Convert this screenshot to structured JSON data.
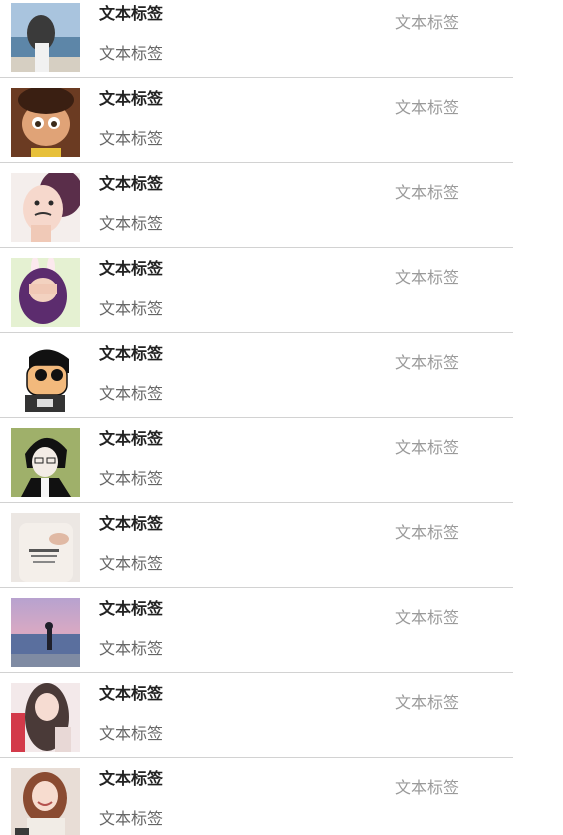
{
  "rows": [
    {
      "title": "文本标签",
      "subtitle": "文本标签",
      "side": "文本标签",
      "avatar": "beach-girl-avatar"
    },
    {
      "title": "文本标签",
      "subtitle": "文本标签",
      "side": "文本标签",
      "avatar": "cartoon-girl-avatar"
    },
    {
      "title": "文本标签",
      "subtitle": "文本标签",
      "side": "文本标签",
      "avatar": "mustache-girl-avatar"
    },
    {
      "title": "文本标签",
      "subtitle": "文本标签",
      "side": "文本标签",
      "avatar": "bunny-ears-girl-avatar"
    },
    {
      "title": "文本标签",
      "subtitle": "文本标签",
      "side": "文本标签",
      "avatar": "sunglasses-cartoon-avatar"
    },
    {
      "title": "文本标签",
      "subtitle": "文本标签",
      "side": "文本标签",
      "avatar": "anime-boy-avatar"
    },
    {
      "title": "文本标签",
      "subtitle": "文本标签",
      "side": "文本标签",
      "avatar": "sweater-avatar"
    },
    {
      "title": "文本标签",
      "subtitle": "文本标签",
      "side": "文本标签",
      "avatar": "sunset-sea-avatar"
    },
    {
      "title": "文本标签",
      "subtitle": "文本标签",
      "side": "文本标签",
      "avatar": "long-hair-girl-avatar"
    },
    {
      "title": "文本标签",
      "subtitle": "文本标签",
      "side": "文本标签",
      "avatar": "smiling-girl-avatar"
    }
  ],
  "colors": {
    "title": "#222222",
    "subtitle": "#666666",
    "side": "#9a9a9a",
    "divider": "#d2d2d2"
  }
}
